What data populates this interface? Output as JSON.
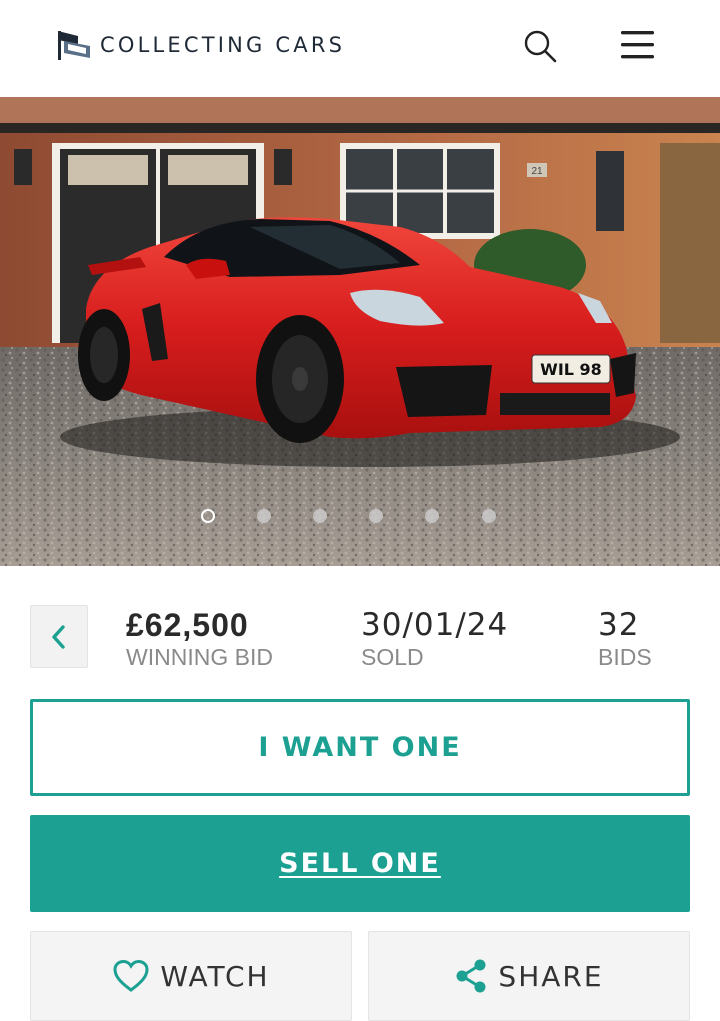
{
  "header": {
    "brand": "COLLECTING CARS",
    "logo_icon": "collecting-cars-flag-logo",
    "search_icon": "search-icon",
    "menu_icon": "hamburger-menu-icon"
  },
  "gallery": {
    "plate_text": "WIL 98",
    "house_number": "21",
    "total_slides": 6,
    "active_slide": 1
  },
  "auction": {
    "back_icon": "chevron-left-icon",
    "winning_bid_value": "£62,500",
    "winning_bid_label": "WINNING BID",
    "sold_date": "30/01/24",
    "sold_label": "SOLD",
    "bids_value": "32",
    "bids_label": "BIDS"
  },
  "actions": {
    "want_label": "I WANT ONE",
    "sell_label": "SELL ONE",
    "watch_label": "WATCH",
    "share_label": "SHARE",
    "watch_icon": "heart-icon",
    "share_icon": "share-icon"
  },
  "colors": {
    "accent": "#1ba092",
    "brand_text": "#1f2a36",
    "car_red": "#d81e1e"
  }
}
